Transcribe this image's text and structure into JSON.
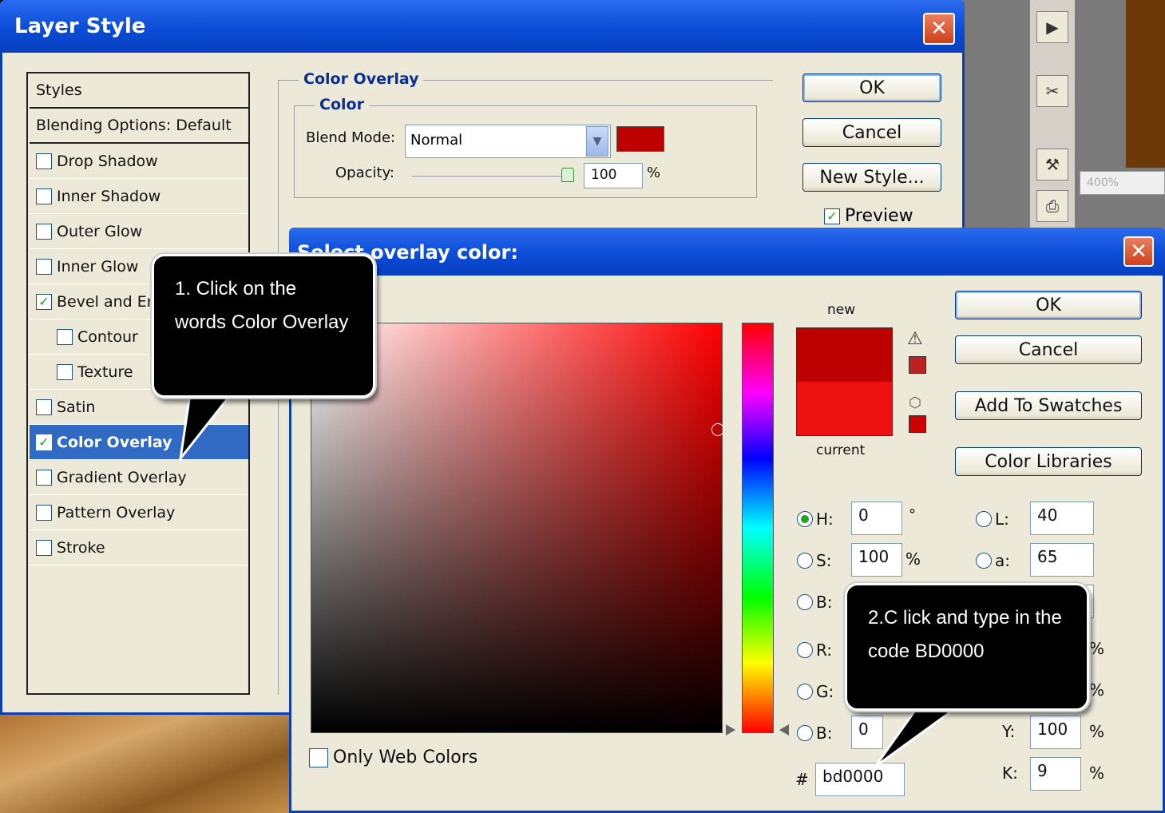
{
  "layer_style": {
    "title": "Layer Style",
    "styles_list": [
      {
        "label": "Styles",
        "checkbox": false,
        "checked": false
      },
      {
        "label": "Blending Options: Default",
        "checkbox": false,
        "checked": false
      },
      {
        "label": "Drop Shadow",
        "checkbox": true,
        "checked": false
      },
      {
        "label": "Inner Shadow",
        "checkbox": true,
        "checked": false
      },
      {
        "label": "Outer Glow",
        "checkbox": true,
        "checked": false
      },
      {
        "label": "Inner Glow",
        "checkbox": true,
        "checked": false
      },
      {
        "label": "Bevel and Er",
        "checkbox": true,
        "checked": true
      },
      {
        "label": "Contour",
        "checkbox": true,
        "checked": false
      },
      {
        "label": "Texture",
        "checkbox": true,
        "checked": false
      },
      {
        "label": "Satin",
        "checkbox": true,
        "checked": false
      },
      {
        "label": "Color Overlay",
        "checkbox": true,
        "checked": true,
        "selected": true
      },
      {
        "label": "Gradient Overlay",
        "checkbox": true,
        "checked": false
      },
      {
        "label": "Pattern Overlay",
        "checkbox": true,
        "checked": false
      },
      {
        "label": "Stroke",
        "checkbox": true,
        "checked": false
      }
    ],
    "section_title": "Color Overlay",
    "group_title": "Color",
    "blend_mode_label": "Blend Mode:",
    "blend_mode_value": "Normal",
    "overlay_color": "#bd0000",
    "opacity_label": "Opacity:",
    "opacity_value": "100",
    "opacity_unit": "%",
    "buttons": {
      "ok": "OK",
      "cancel": "Cancel",
      "new_style": "New Style...",
      "preview": "Preview"
    },
    "preview_checked": true
  },
  "picker": {
    "title": "Select overlay color:",
    "new_label": "new",
    "current_label": "current",
    "new_color": "#bd0000",
    "current_color": "#ee1111",
    "buttons": {
      "ok": "OK",
      "cancel": "Cancel",
      "add_swatches": "Add To Swatches",
      "libraries": "Color Libraries"
    },
    "fields": {
      "h_label": "H:",
      "h_value": "0",
      "h_unit": "°",
      "s_label": "S:",
      "s_value": "100",
      "s_unit": "%",
      "b_label": "B:",
      "r_label": "R:",
      "g_label": "G:",
      "bl_label": "B:",
      "bl_value": "0",
      "l_label": "L:",
      "l_value": "40",
      "a_label": "a:",
      "a_value": "65",
      "y_label": "Y:",
      "y_value": "100",
      "y_unit": "%",
      "k_label": "K:",
      "k_value": "9",
      "k_unit": "%",
      "pct1": "%",
      "pct2": "%"
    },
    "hex_label": "#",
    "hex_value": "bd0000",
    "web_colors_label": "Only Web Colors"
  },
  "background": {
    "zoom": "400%"
  },
  "callouts": {
    "one": "1. Click on the words Color Overlay",
    "two": "2.C lick and type in the code BD0000"
  }
}
